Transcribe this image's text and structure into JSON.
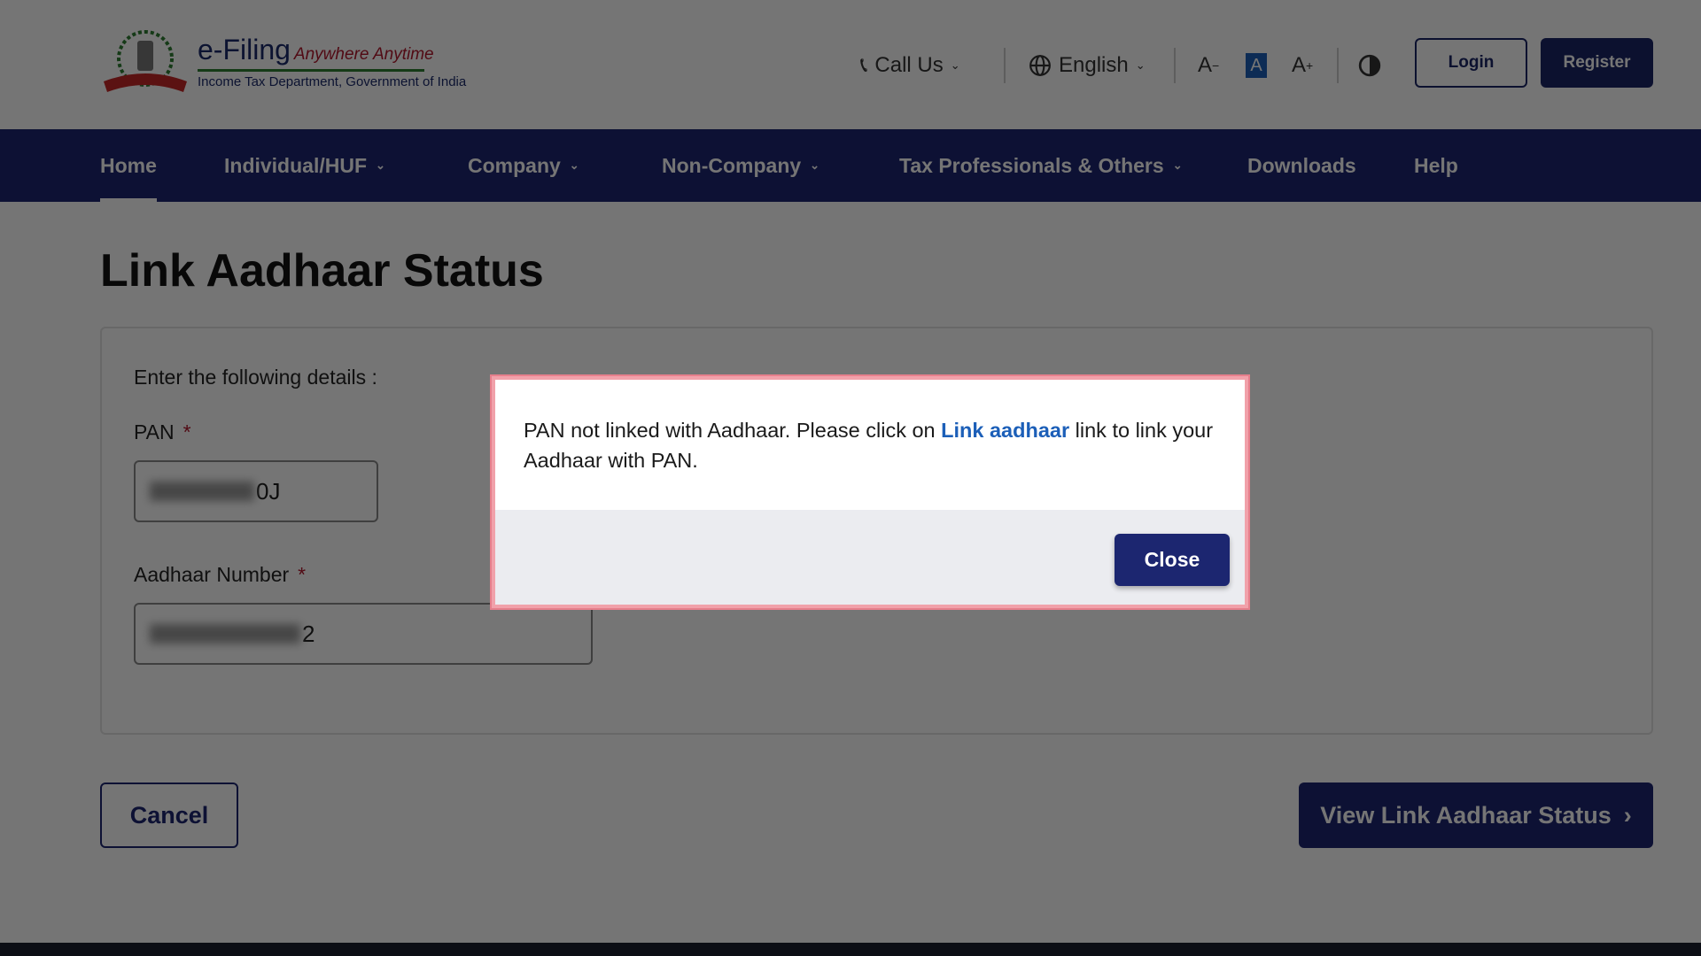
{
  "header": {
    "logo": {
      "brand": "e-Filing",
      "tagline": "Anywhere Anytime",
      "subtitle": "Income Tax Department, Government of India",
      "emblem_text": "INCOME TAX DEPARTMENT"
    },
    "call_us": "Call Us",
    "language": "English",
    "font_decrease": "A",
    "font_default": "A",
    "font_increase": "A",
    "login": "Login",
    "register": "Register"
  },
  "nav": {
    "items": [
      {
        "label": "Home",
        "dropdown": false,
        "active": true
      },
      {
        "label": "Individual/HUF",
        "dropdown": true
      },
      {
        "label": "Company",
        "dropdown": true
      },
      {
        "label": "Non-Company",
        "dropdown": true
      },
      {
        "label": "Tax Professionals & Others",
        "dropdown": true
      },
      {
        "label": "Downloads",
        "dropdown": false
      },
      {
        "label": "Help",
        "dropdown": false
      }
    ]
  },
  "page": {
    "title": "Link Aadhaar Status",
    "instructions": "Enter the following details :",
    "pan_label": "PAN",
    "pan_value_visible": "0J",
    "aadhaar_label": "Aadhaar Number",
    "aadhaar_value_visible": "2",
    "required_mark": "*",
    "cancel": "Cancel",
    "view_status": "View Link Aadhaar Status"
  },
  "dialog": {
    "message_before": "PAN not linked with Aadhaar. Please click on ",
    "link_text": "Link aadhaar",
    "message_after": " link to link your Aadhaar with PAN.",
    "close": "Close"
  },
  "colors": {
    "primary": "#1c2670",
    "link": "#1c5fb8",
    "required": "#b0162b",
    "dialog_border": "#f1a1aa"
  }
}
